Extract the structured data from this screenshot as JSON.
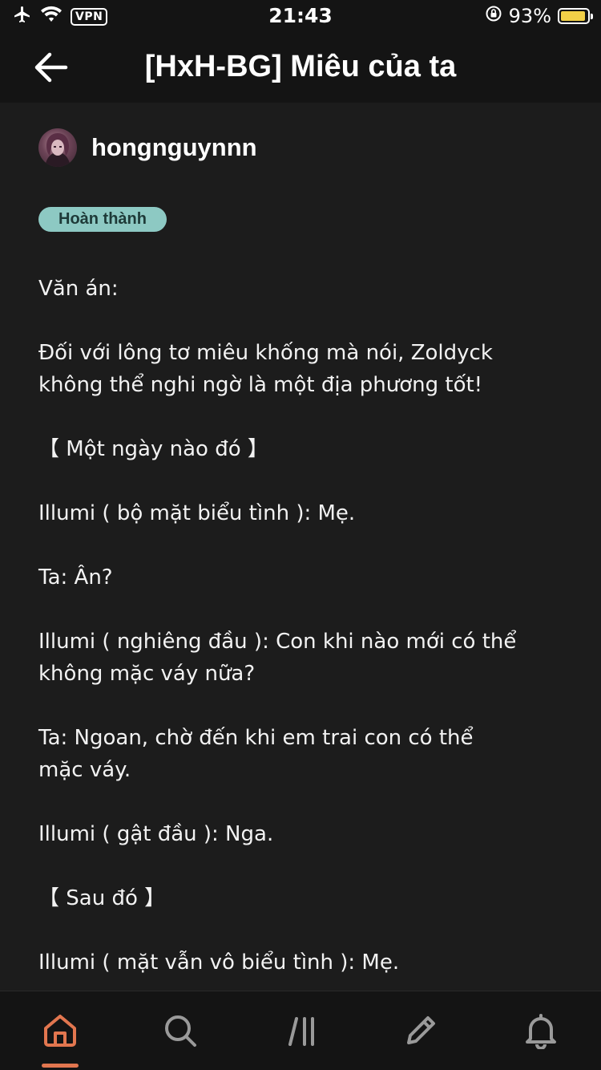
{
  "status_bar": {
    "vpn": "VPN",
    "time": "21:43",
    "battery_percent": "93%",
    "battery_level": 0.93,
    "icons": [
      "airplane-icon",
      "wifi-icon",
      "orientation-lock-icon",
      "battery-icon"
    ]
  },
  "header": {
    "title": "[HxH-BG] Miêu của ta",
    "back_icon": "arrow-left-icon"
  },
  "author": {
    "name": "hongnguynnn"
  },
  "badge": {
    "label": "Hoàn thành",
    "color": "#8dc9c3"
  },
  "story": {
    "paragraphs": [
      "Văn án:",
      "Đối với lông tơ miêu khống mà nói, Zoldyck\nkhông thể nghi ngờ là một địa phương tốt!",
      "【 Một ngày nào đó 】",
      "Illumi ( bộ mặt biểu tình ): Mẹ.",
      "Ta: Ân?",
      "Illumi ( nghiêng đầu ): Con khi nào mới có thể\nkhông mặc váy nữa?",
      "Ta: Ngoan, chờ đến khi em trai con có thể\nmặc váy.",
      "Illumi ( gật đầu ): Nga.",
      "【 Sau đó 】",
      "Illumi ( mặt vẫn vô biểu tình ): Mẹ."
    ]
  },
  "bottom_nav": {
    "items": [
      "home-icon",
      "search-icon",
      "library-icon",
      "write-icon",
      "notifications-icon"
    ],
    "active": "home-icon",
    "accent_color": "#e2764f"
  }
}
